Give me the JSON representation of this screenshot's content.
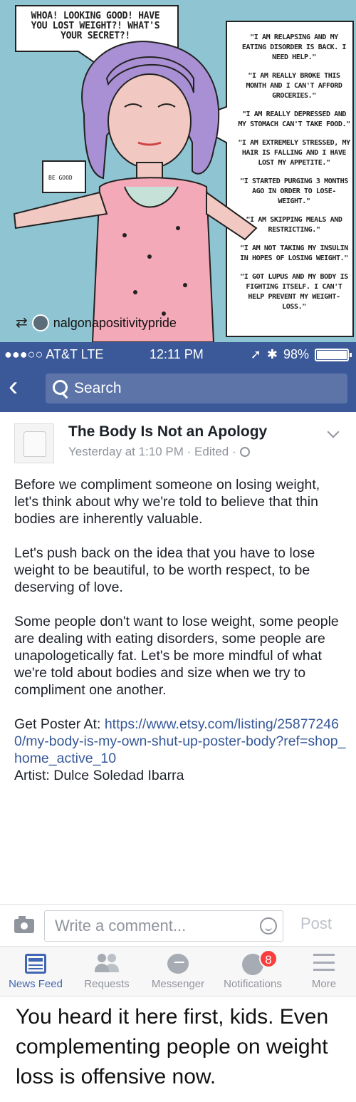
{
  "poster": {
    "speech_left": "WHOA! LOOKING GOOD! HAVE YOU LOST WEIGHT?! WHAT'S YOUR SECRET?!",
    "pill_text": "BE GOOD",
    "quotes": [
      "\"I AM RELAPSING AND MY EATING DISORDER IS BACK. I NEED HELP.\"",
      "\"I AM REALLY BROKE THIS MONTH AND I CAN'T AFFORD GROCERIES.\"",
      "\"I AM REALLY DEPRESSED AND MY STOMACH CAN'T TAKE FOOD.\"",
      "\"I AM EXTREMELY STRESSED, MY HAIR IS FALLING AND I HAVE LOST MY APPETITE.\"",
      "\"I STARTED PURGING 3 MONTHS AGO IN ORDER TO LOSE-WEIGHT.\"",
      "\"I AM SKIPPING MEALS AND RESTRICTING.\"",
      "\"I AM NOT TAKING MY INSULIN IN HOPES OF LOSING WEIGHT.\"",
      "\"I GOT LUPUS AND MY BODY IS FIGHTING ITSELF. I CAN'T HELP PREVENT MY WEIGHT-LOSS.\""
    ],
    "repost_icon": "repost-icon",
    "repost_user": "nalgonapositivitypride"
  },
  "status_bar": {
    "carrier": "●●●○○ AT&T  LTE",
    "time": "12:11 PM",
    "location_arrow": "➚",
    "bluetooth": "✱",
    "battery_text": "98%",
    "battery_level": 0.98
  },
  "nav": {
    "back_glyph": "‹",
    "search_placeholder": "Search"
  },
  "post": {
    "author": "The Body Is Not an Apology",
    "meta": "Yesterday at 1:10 PM · Edited ·",
    "paragraphs": [
      "Before we compliment someone on losing weight, let's think about why we're told to believe that thin bodies are inherently valuable.",
      "Let's push back on the idea that you have to lose weight to be beautiful, to be worth respect, to be deserving of love.",
      "Some people don't want to lose weight, some people are dealing with eating disorders, some people are unapologetically fat. Let's be more mindful of what we're told about bodies and size when we try to compliment one another."
    ],
    "poster_prefix": "Get Poster At: ",
    "poster_link": "https://www.etsy.com/listing/258772460/my-body-is-my-own-shut-up-poster-body?ref=shop_home_active_10",
    "artist": "Artist: Dulce Soledad Ibarra"
  },
  "comment": {
    "placeholder": "Write a comment...",
    "post_label": "Post"
  },
  "tabs": [
    {
      "label": "News Feed",
      "icon": "news-feed-icon",
      "active": true
    },
    {
      "label": "Requests",
      "icon": "friend-requests-icon",
      "active": false
    },
    {
      "label": "Messenger",
      "icon": "messenger-icon",
      "active": false
    },
    {
      "label": "Notifications",
      "icon": "globe-icon",
      "active": false,
      "badge": "8"
    },
    {
      "label": "More",
      "icon": "hamburger-icon",
      "active": false
    }
  ],
  "caption": "You heard it here first, kids. Even complementing people on weight loss is offensive now.",
  "colors": {
    "facebook_blue": "#3b5998",
    "link_blue": "#365899",
    "poster_bg": "#8fc5d2",
    "hair": "#a98fd3",
    "badge_red": "#fa3e3e"
  }
}
